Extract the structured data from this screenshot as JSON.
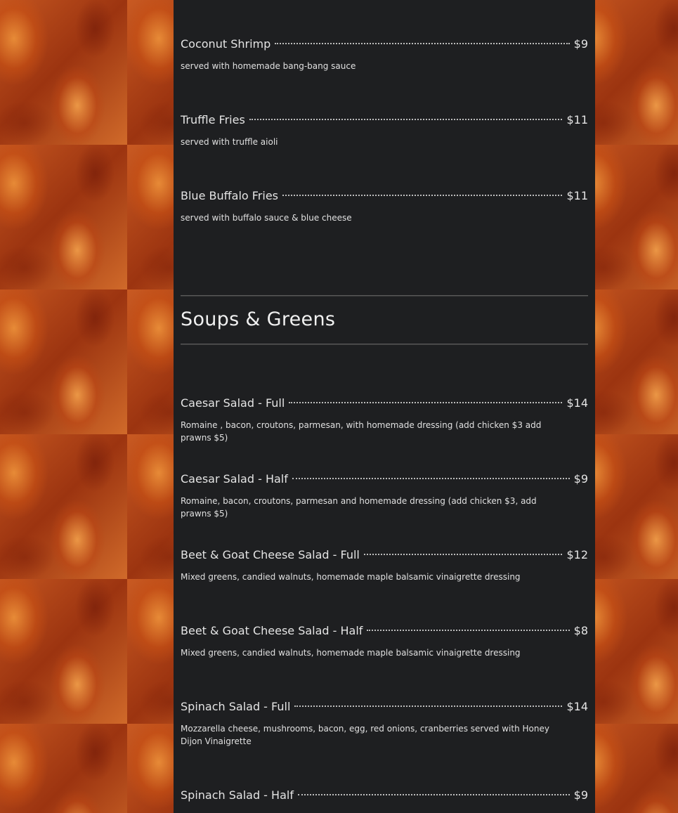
{
  "appetizers": [
    {
      "name": "Coconut Shrimp",
      "price": "$9",
      "desc": "served with homemade bang-bang sauce"
    },
    {
      "name": "Truffle Fries",
      "price": "$11",
      "desc": "served with truffle aioli"
    },
    {
      "name": "Blue Buffalo Fries",
      "price": "$11",
      "desc": "served with buffalo sauce & blue cheese"
    }
  ],
  "soups_section": {
    "title": "Soups & Greens",
    "items": [
      {
        "name": "Caesar Salad - Full",
        "price": "$14",
        "desc": "Romaine , bacon, croutons, parmesan, with homemade dressing (add chicken $3 add prawns $5)"
      },
      {
        "name": "Caesar Salad - Half",
        "price": "$9",
        "desc": "Romaine, bacon, croutons, parmesan and homemade dressing (add chicken $3, add prawns $5)"
      },
      {
        "name": "Beet & Goat Cheese Salad - Full",
        "price": "$12",
        "desc": "Mixed greens, candied walnuts, homemade maple balsamic vinaigrette dressing"
      },
      {
        "name": "Beet & Goat Cheese Salad - Half",
        "price": "$8",
        "desc": "Mixed greens, candied walnuts, homemade maple balsamic vinaigrette dressing"
      },
      {
        "name": "Spinach Salad - Full",
        "price": "$14",
        "desc": "Mozzarella cheese, mushrooms, bacon, egg, red onions, cranberries served with Honey Dijon Vinaigrette"
      },
      {
        "name": "Spinach Salad - Half",
        "price": "$9",
        "desc": ""
      }
    ]
  },
  "colors": {
    "panel_bg": "#1e1f21",
    "text": "#e4e4e4",
    "background_pattern": "fried chicken wings"
  }
}
